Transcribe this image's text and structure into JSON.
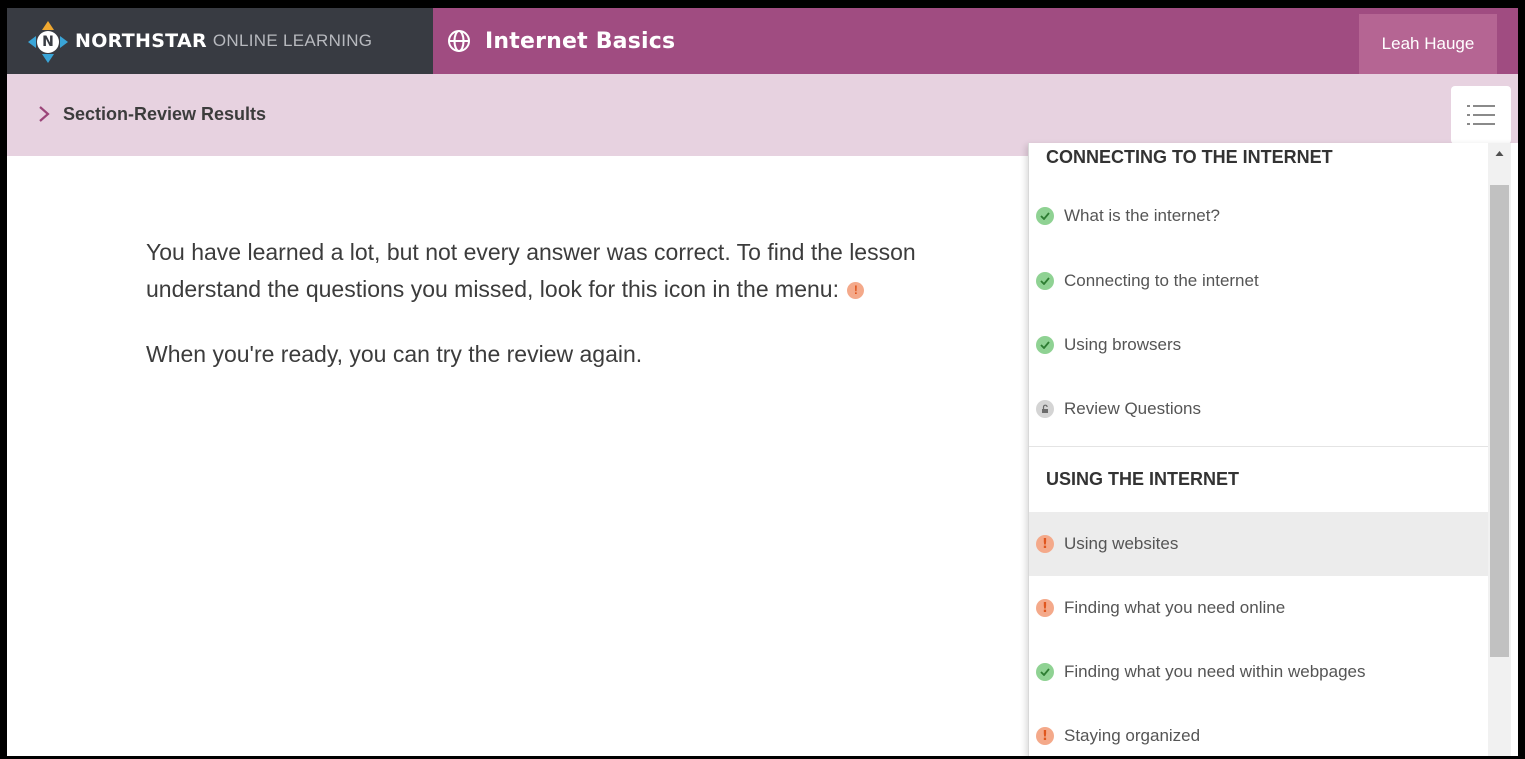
{
  "header": {
    "brand_bold": "NORTHSTAR",
    "brand_light": "ONLINE LEARNING",
    "logo_letter": "N",
    "course_title": "Internet Basics",
    "user_name": "Leah Hauge"
  },
  "subheader": {
    "section_title": "Section-Review Results"
  },
  "main": {
    "line1": "You have learned a lot, but not every answer was correct. To find the lesson",
    "line2": "understand the questions you missed, look for this icon in the menu:",
    "warn_glyph": "!",
    "line3": "When you're ready, you can try the review again."
  },
  "menu": {
    "groups": [
      {
        "title": "CONNECTING TO THE INTERNET",
        "items": [
          {
            "label": "What is the internet?",
            "status": "complete"
          },
          {
            "label": "Connecting to the internet",
            "status": "complete"
          },
          {
            "label": "Using browsers",
            "status": "complete"
          },
          {
            "label": "Review Questions",
            "status": "unlocked"
          }
        ]
      },
      {
        "title": "USING THE INTERNET",
        "items": [
          {
            "label": "Using websites",
            "status": "needs-review"
          },
          {
            "label": "Finding what you need online",
            "status": "needs-review"
          },
          {
            "label": "Finding what you need within webpages",
            "status": "complete"
          },
          {
            "label": "Staying organized",
            "status": "needs-review"
          }
        ]
      }
    ],
    "warn_glyph": "!"
  },
  "colors": {
    "brand_dark": "#383b42",
    "course_bar": "#a04c81",
    "user_box": "#b56593",
    "subbar": "#e7d2e0",
    "ok": "#8fd293",
    "warn": "#f4a98a",
    "warn_text": "#e0561e"
  }
}
